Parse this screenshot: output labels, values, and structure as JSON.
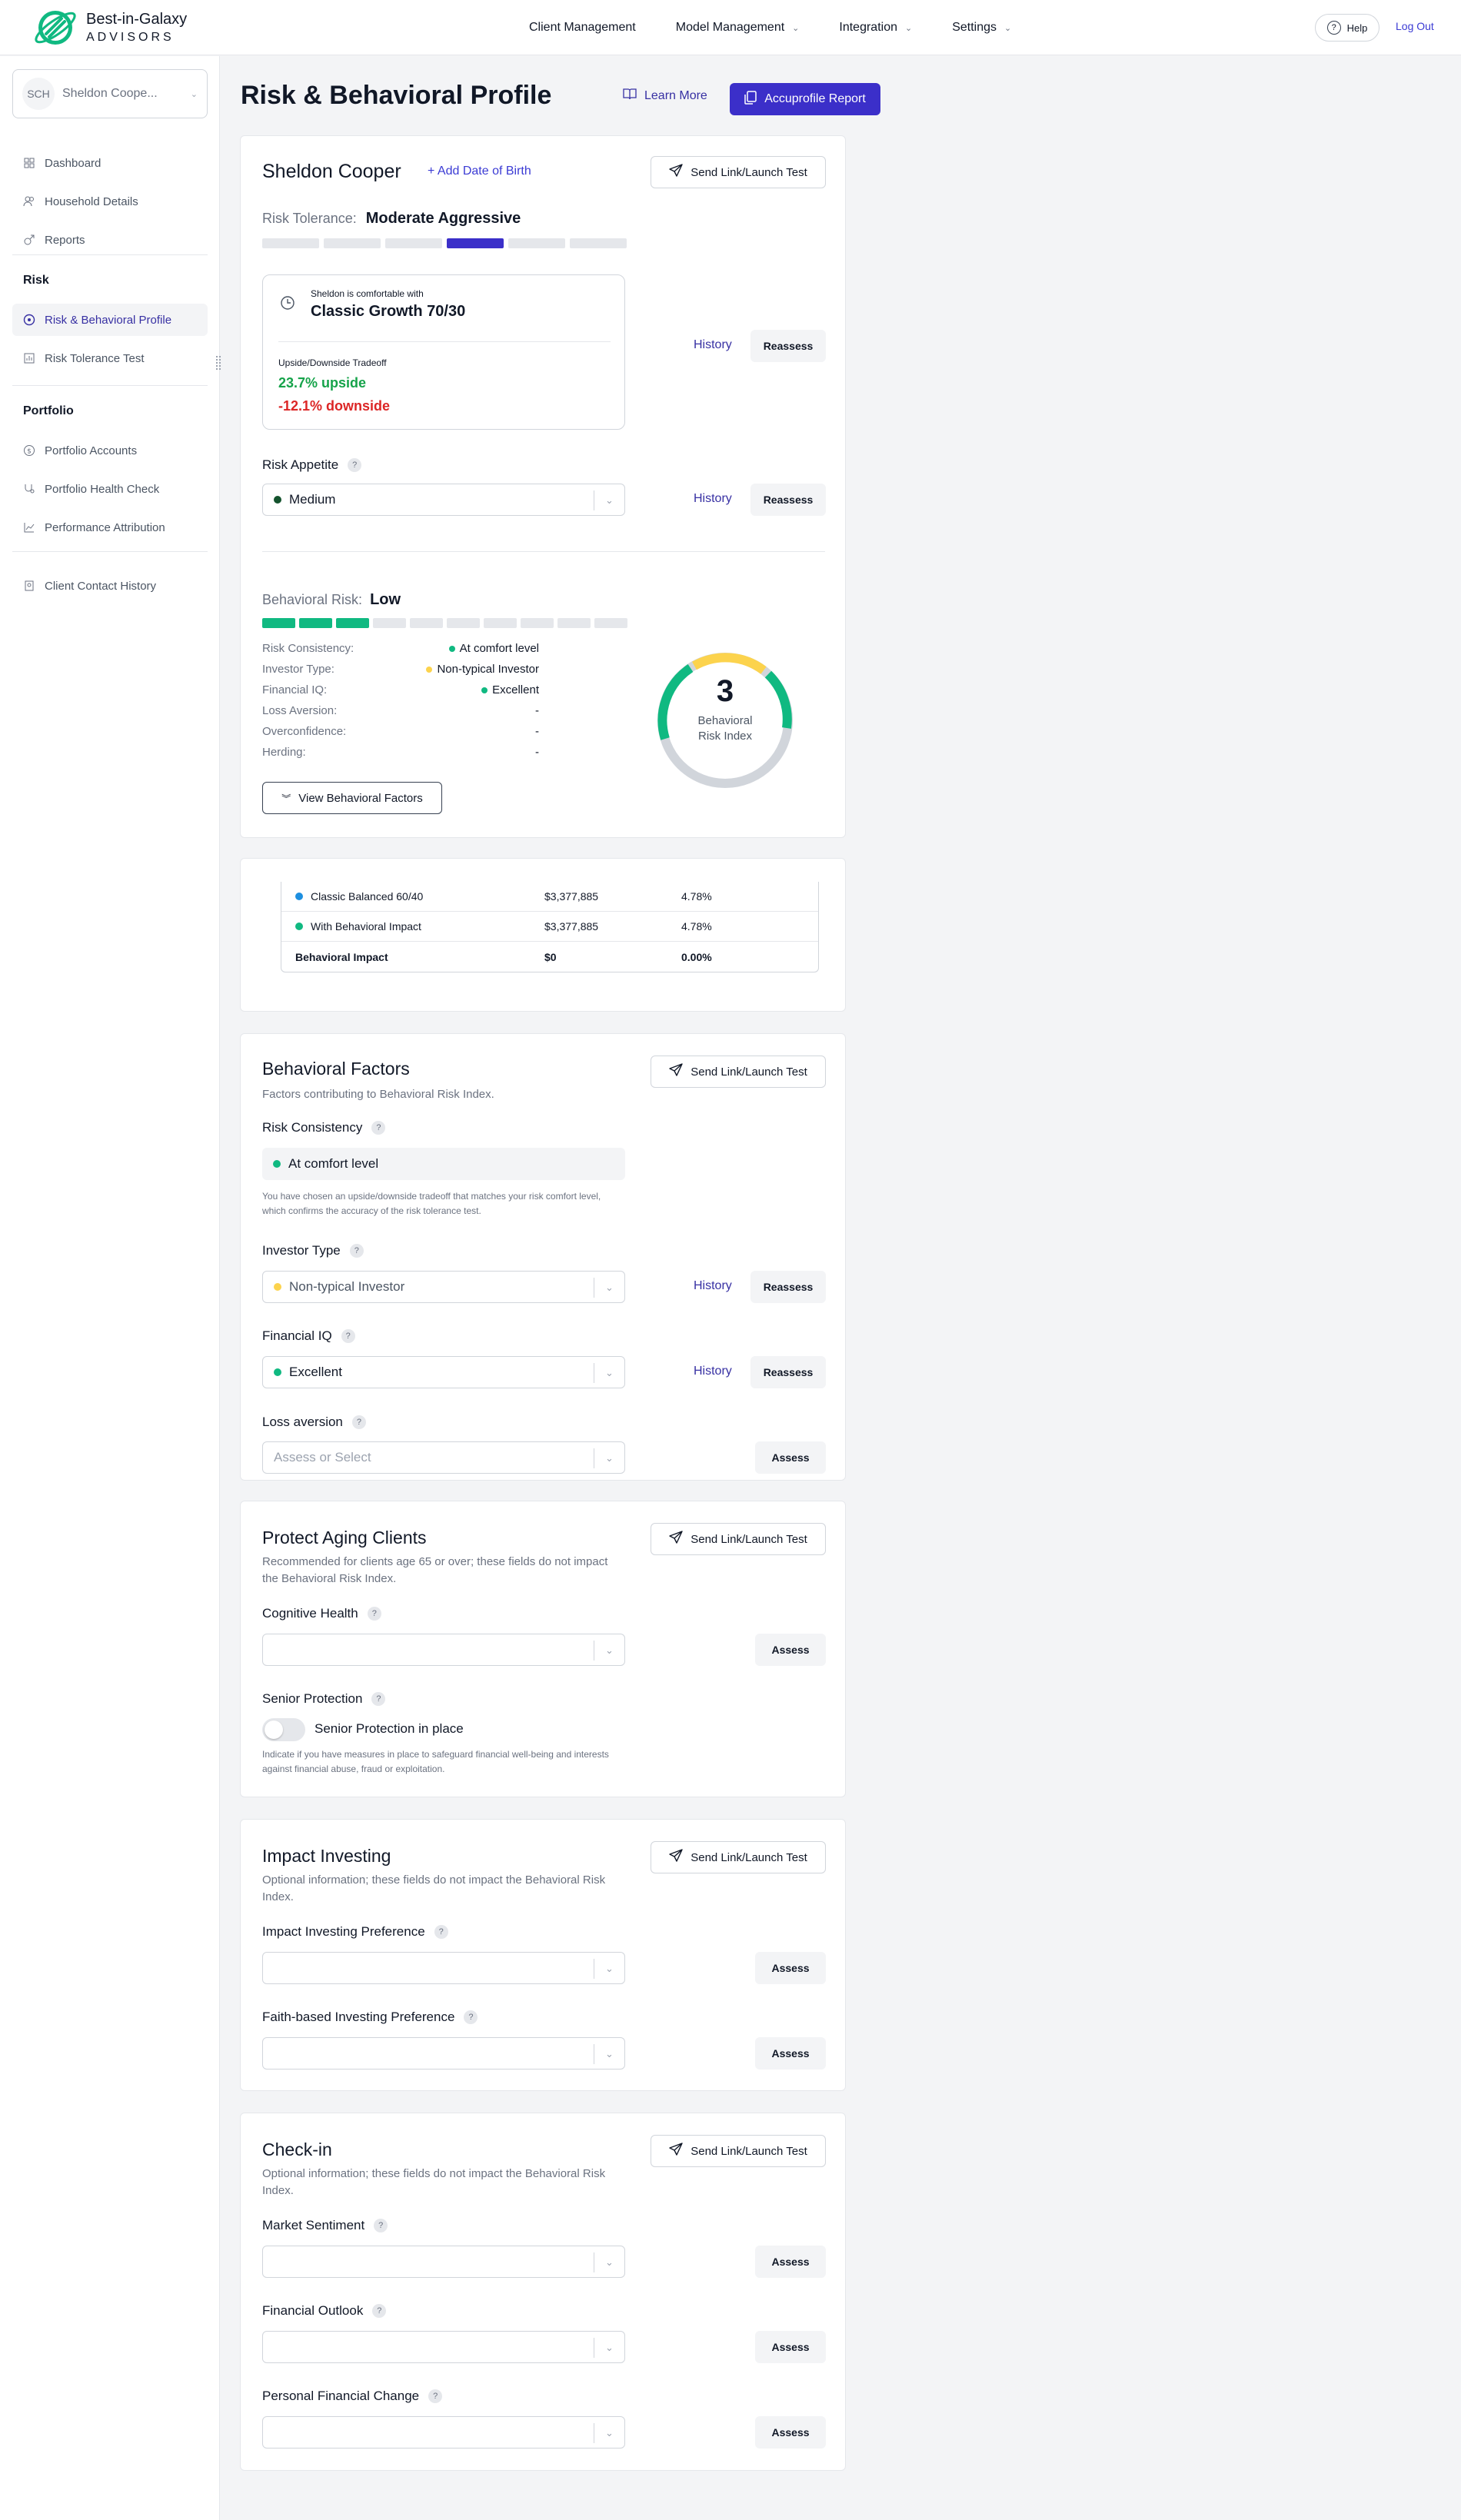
{
  "brand": {
    "line1": "Best-in-Galaxy",
    "line2": "ADVISORS"
  },
  "nav": {
    "items": [
      {
        "label": "Client Management",
        "has_menu": false
      },
      {
        "label": "Model Management",
        "has_menu": true
      },
      {
        "label": "Integration",
        "has_menu": true
      },
      {
        "label": "Settings",
        "has_menu": true
      }
    ],
    "help": "Help",
    "logout": "Log Out"
  },
  "sidebar": {
    "client_initials": "SCH",
    "client_name": "Sheldon Coope...",
    "items_top": [
      "Dashboard",
      "Household Details",
      "Reports"
    ],
    "risk_heading": "Risk",
    "risk_items": [
      "Risk & Behavioral Profile",
      "Risk Tolerance Test"
    ],
    "portfolio_heading": "Portfolio",
    "portfolio_items": [
      "Portfolio Accounts",
      "Portfolio Health Check",
      "Performance Attribution"
    ],
    "bottom_items": [
      "Client Contact History"
    ]
  },
  "header": {
    "title": "Risk & Behavioral Profile",
    "learn_more": "Learn More",
    "report_button": "Accuprofile Report"
  },
  "profile": {
    "client_name": "Sheldon Cooper",
    "add_dob": "+ Add Date of Birth",
    "send_link": "Send Link/Launch Test",
    "risk_tolerance_label": "Risk Tolerance:",
    "risk_tolerance_value": "Moderate Aggressive",
    "risk_tolerance_level": 4,
    "risk_tolerance_segments": 6,
    "comfort_line": "Sheldon is comfortable with",
    "comfort_model": "Classic Growth 70/30",
    "tradeoff_label": "Upside/Downside Tradeoff",
    "upside": "23.7% upside",
    "downside": "-12.1% downside",
    "history": "History",
    "reassess": "Reassess",
    "risk_appetite_label": "Risk Appetite",
    "risk_appetite_value": "Medium",
    "behavioral_risk_label": "Behavioral Risk:",
    "behavioral_risk_value": "Low",
    "behavioral_level": 3,
    "behavioral_segments": 10,
    "factors": [
      {
        "label": "Risk Consistency:",
        "value": "At comfort level",
        "color": "#10b981"
      },
      {
        "label": "Investor Type:",
        "value": "Non-typical Investor",
        "color": "#fcd34d"
      },
      {
        "label": "Financial IQ:",
        "value": "Excellent",
        "color": "#10b981"
      },
      {
        "label": "Loss Aversion:",
        "value": "-",
        "color": ""
      },
      {
        "label": "Overconfidence:",
        "value": "-",
        "color": ""
      },
      {
        "label": "Herding:",
        "value": "-",
        "color": ""
      }
    ],
    "gauge_value": "3",
    "gauge_label_1": "Behavioral",
    "gauge_label_2": "Risk Index",
    "view_factors": "View Behavioral Factors"
  },
  "impact_table": {
    "rows": [
      {
        "name": "Classic Balanced 60/40",
        "value": "$3,377,885",
        "pct": "4.78%",
        "color": "#1d8fe0"
      },
      {
        "name": "With Behavioral Impact",
        "value": "$3,377,885",
        "pct": "4.78%",
        "color": "#10b981"
      },
      {
        "name": "Behavioral Impact",
        "value": "$0",
        "pct": "0.00%",
        "color": ""
      }
    ]
  },
  "behavioral_factors": {
    "title": "Behavioral Factors",
    "subtitle": "Factors contributing to Behavioral Risk Index.",
    "send_link": "Send Link/Launch Test",
    "risk_consistency_label": "Risk Consistency",
    "risk_consistency_value": "At comfort level",
    "risk_consistency_note": "You have chosen an upside/downside tradeoff that matches your risk comfort level, which confirms the accuracy of the risk tolerance test.",
    "investor_type_label": "Investor Type",
    "investor_type_value": "Non-typical Investor",
    "financial_iq_label": "Financial IQ",
    "financial_iq_value": "Excellent",
    "loss_aversion_label": "Loss aversion",
    "loss_aversion_placeholder": "Assess or Select",
    "history": "History",
    "reassess": "Reassess",
    "assess": "Assess"
  },
  "aging": {
    "title": "Protect Aging Clients",
    "subtitle": "Recommended for clients age 65 or over; these fields do not impact the Behavioral Risk Index.",
    "send_link": "Send Link/Launch Test",
    "cognitive_label": "Cognitive Health",
    "senior_label": "Senior Protection",
    "toggle_label": "Senior Protection in place",
    "toggle_on": false,
    "note": "Indicate if you have measures in place to safeguard financial well-being and interests against financial abuse, fraud or exploitation.",
    "assess": "Assess"
  },
  "impact_investing": {
    "title": "Impact Investing",
    "subtitle": "Optional information; these fields do not impact the Behavioral Risk Index.",
    "send_link": "Send Link/Launch Test",
    "pref_label": "Impact Investing Preference",
    "faith_label": "Faith-based Investing Preference",
    "assess": "Assess"
  },
  "checkin": {
    "title": "Check-in",
    "subtitle": "Optional information; these fields do not impact the Behavioral Risk Index.",
    "send_link": "Send Link/Launch Test",
    "market_label": "Market Sentiment",
    "outlook_label": "Financial Outlook",
    "change_label": "Personal Financial Change",
    "assess": "Assess"
  },
  "colors": {
    "accent": "#3b2fc9",
    "link": "#3730a3",
    "positive": "#16a34a",
    "negative": "#dc2626",
    "teal": "#10b981",
    "yellow": "#fcd34d"
  }
}
